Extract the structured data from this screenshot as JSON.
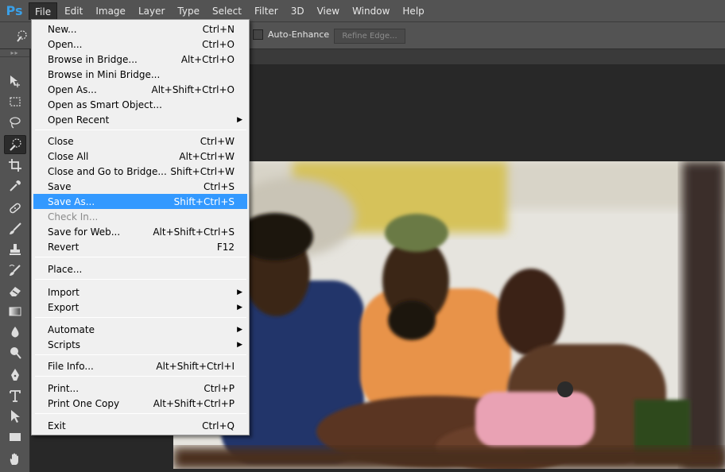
{
  "app": {
    "logo": "Ps"
  },
  "menubar": {
    "items": [
      "File",
      "Edit",
      "Image",
      "Layer",
      "Type",
      "Select",
      "Filter",
      "3D",
      "View",
      "Window",
      "Help"
    ],
    "active": "File"
  },
  "options": {
    "auto_enhance_label": "Auto-Enhance",
    "auto_enhance_checked": false,
    "refine_edge_label": "Refine Edge..."
  },
  "toolbox": {
    "tools": [
      "move-tool",
      "marquee-tool",
      "lasso-tool",
      "quick-selection-tool",
      "crop-tool",
      "eyedropper-tool",
      "healing-brush-tool",
      "brush-tool",
      "clone-stamp-tool",
      "history-brush-tool",
      "eraser-tool",
      "gradient-tool",
      "blur-tool",
      "dodge-tool",
      "pen-tool",
      "type-tool",
      "path-selection-tool",
      "rectangle-tool",
      "hand-tool"
    ],
    "selected": "quick-selection-tool"
  },
  "file_menu": {
    "items": [
      {
        "label": "New...",
        "shortcut": "Ctrl+N"
      },
      {
        "label": "Open...",
        "shortcut": "Ctrl+O"
      },
      {
        "label": "Browse in Bridge...",
        "shortcut": "Alt+Ctrl+O"
      },
      {
        "label": "Browse in Mini Bridge...",
        "shortcut": ""
      },
      {
        "label": "Open As...",
        "shortcut": "Alt+Shift+Ctrl+O"
      },
      {
        "label": "Open as Smart Object...",
        "shortcut": ""
      },
      {
        "label": "Open Recent",
        "shortcut": ""
      },
      {
        "label": "Close",
        "shortcut": "Ctrl+W"
      },
      {
        "label": "Close All",
        "shortcut": "Alt+Ctrl+W"
      },
      {
        "label": "Close and Go to Bridge...",
        "shortcut": "Shift+Ctrl+W"
      },
      {
        "label": "Save",
        "shortcut": "Ctrl+S"
      },
      {
        "label": "Save As...",
        "shortcut": "Shift+Ctrl+S"
      },
      {
        "label": "Check In...",
        "shortcut": ""
      },
      {
        "label": "Save for Web...",
        "shortcut": "Alt+Shift+Ctrl+S"
      },
      {
        "label": "Revert",
        "shortcut": "F12"
      },
      {
        "label": "Place...",
        "shortcut": ""
      },
      {
        "label": "Import",
        "shortcut": ""
      },
      {
        "label": "Export",
        "shortcut": ""
      },
      {
        "label": "Automate",
        "shortcut": ""
      },
      {
        "label": "Scripts",
        "shortcut": ""
      },
      {
        "label": "File Info...",
        "shortcut": "Alt+Shift+Ctrl+I"
      },
      {
        "label": "Print...",
        "shortcut": "Ctrl+P"
      },
      {
        "label": "Print One Copy",
        "shortcut": "Alt+Shift+Ctrl+P"
      },
      {
        "label": "Exit",
        "shortcut": "Ctrl+Q"
      }
    ],
    "highlighted": "Save As...",
    "disabled": [
      "Check In..."
    ],
    "submenus": [
      "Open Recent",
      "Import",
      "Export",
      "Automate",
      "Scripts"
    ]
  },
  "colors": {
    "highlight": "#3399ff",
    "menu_bg": "#f0f0f0",
    "chrome": "#535353",
    "workspace": "#282828"
  }
}
